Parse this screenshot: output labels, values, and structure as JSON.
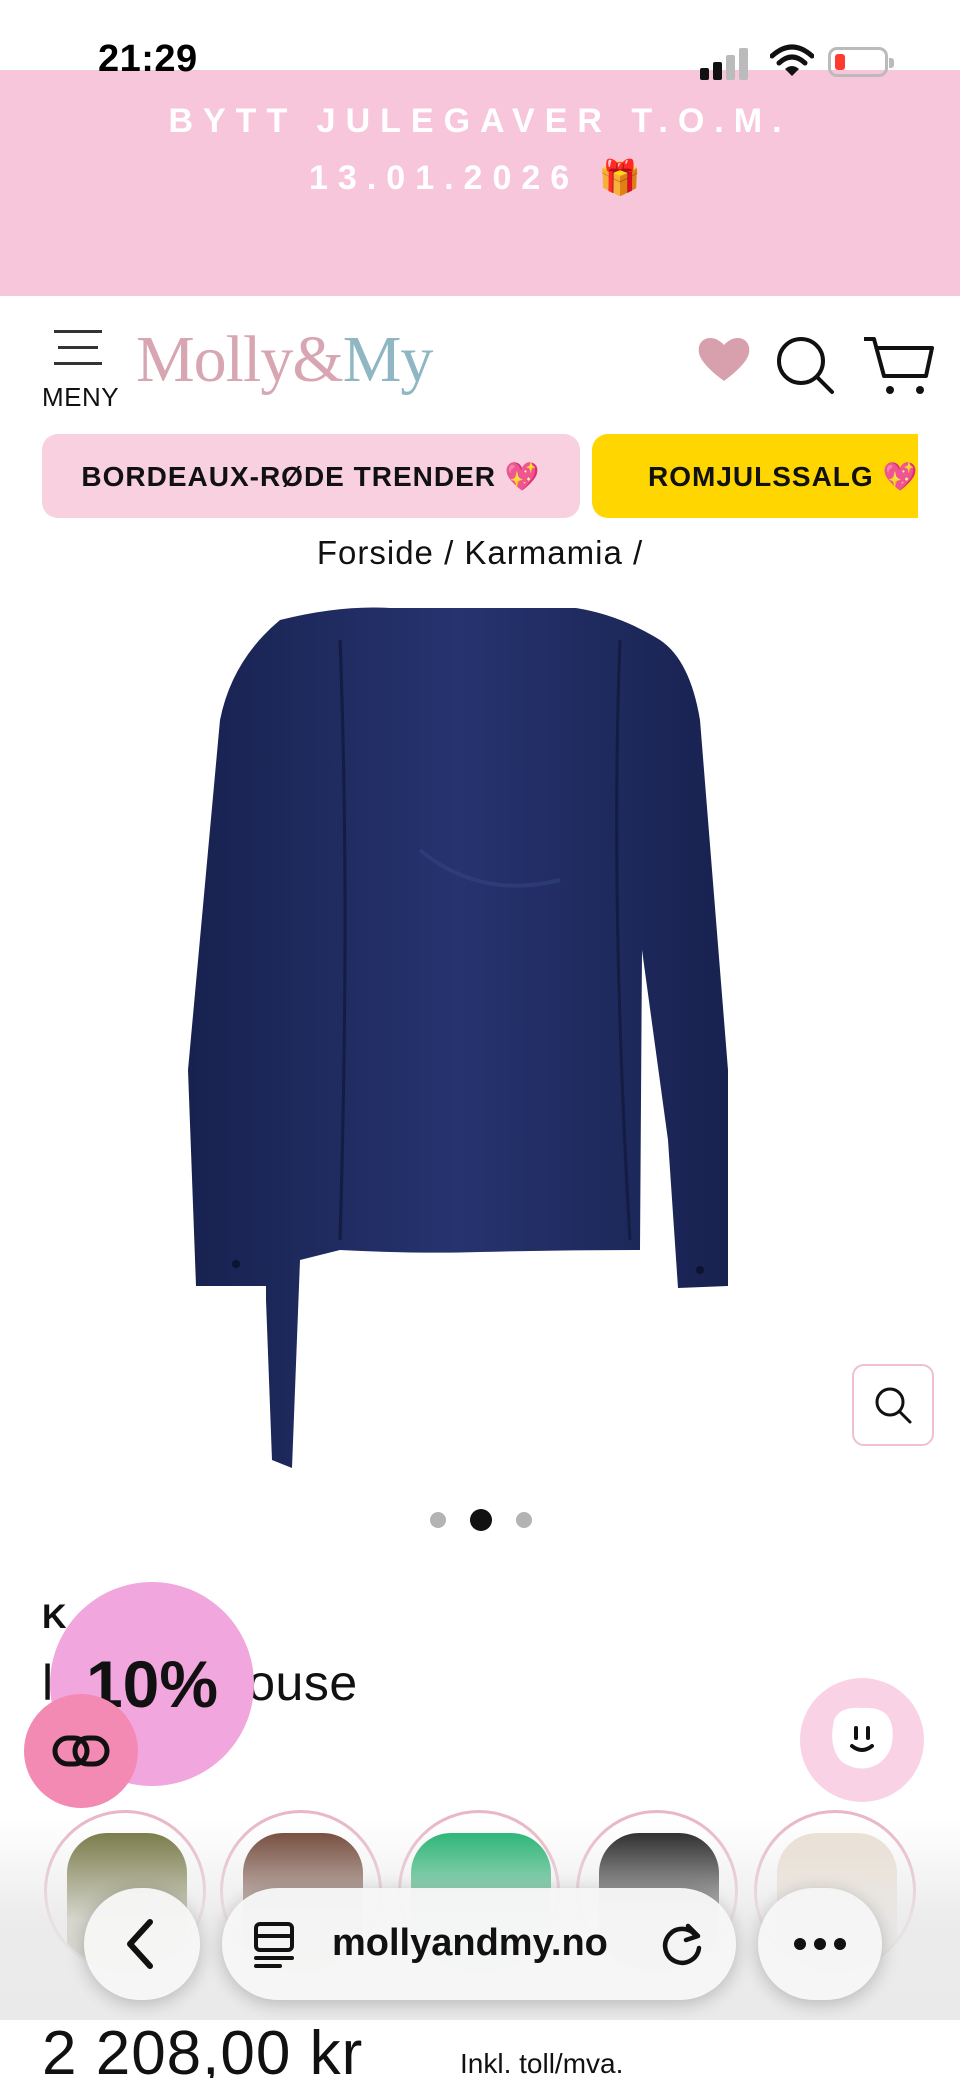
{
  "status_bar": {
    "time": "21:29"
  },
  "promo": {
    "line1": "BYTT JULEGAVER T.O.M.",
    "line2": "13.01.2026 🎁"
  },
  "header": {
    "menu_label": "MENY",
    "logo_part1": "Molly&",
    "logo_part2": "My",
    "logo_color1": "#d7a6b2",
    "logo_color2": "#8fb6c3",
    "icons": [
      "heart-icon",
      "search-icon",
      "cart-icon"
    ]
  },
  "categories": [
    {
      "label": "BORDEAUX-RØDE TRENDER 💖",
      "color": "#f8d0e0"
    },
    {
      "label": "ROMJULSSALG 💖 F",
      "color": "#ffd600"
    }
  ],
  "breadcrumb": {
    "home": "Forside",
    "brand": "Karmamia",
    "sep": "/"
  },
  "product": {
    "brand_partial": "K",
    "name_start": "l",
    "name_end": "louse",
    "image_count": 3,
    "active_image": 1,
    "discount_badge": "10%",
    "price": "2 208,00 kr",
    "tax_note": "Inkl. toll/mva.",
    "garment_color": "#1e2a5a"
  },
  "color_swatches": [
    {
      "name": "olive",
      "color": "#6e7038"
    },
    {
      "name": "brown",
      "color": "#6a3e2e"
    },
    {
      "name": "green",
      "color": "#19b06a"
    },
    {
      "name": "black",
      "color": "#1a1a1a"
    },
    {
      "name": "cream",
      "color": "#ebe0d2"
    }
  ],
  "browser": {
    "url": "mollyandmy.no",
    "buttons": [
      "back-icon",
      "reader-icon",
      "reload-icon",
      "more-icon"
    ]
  }
}
